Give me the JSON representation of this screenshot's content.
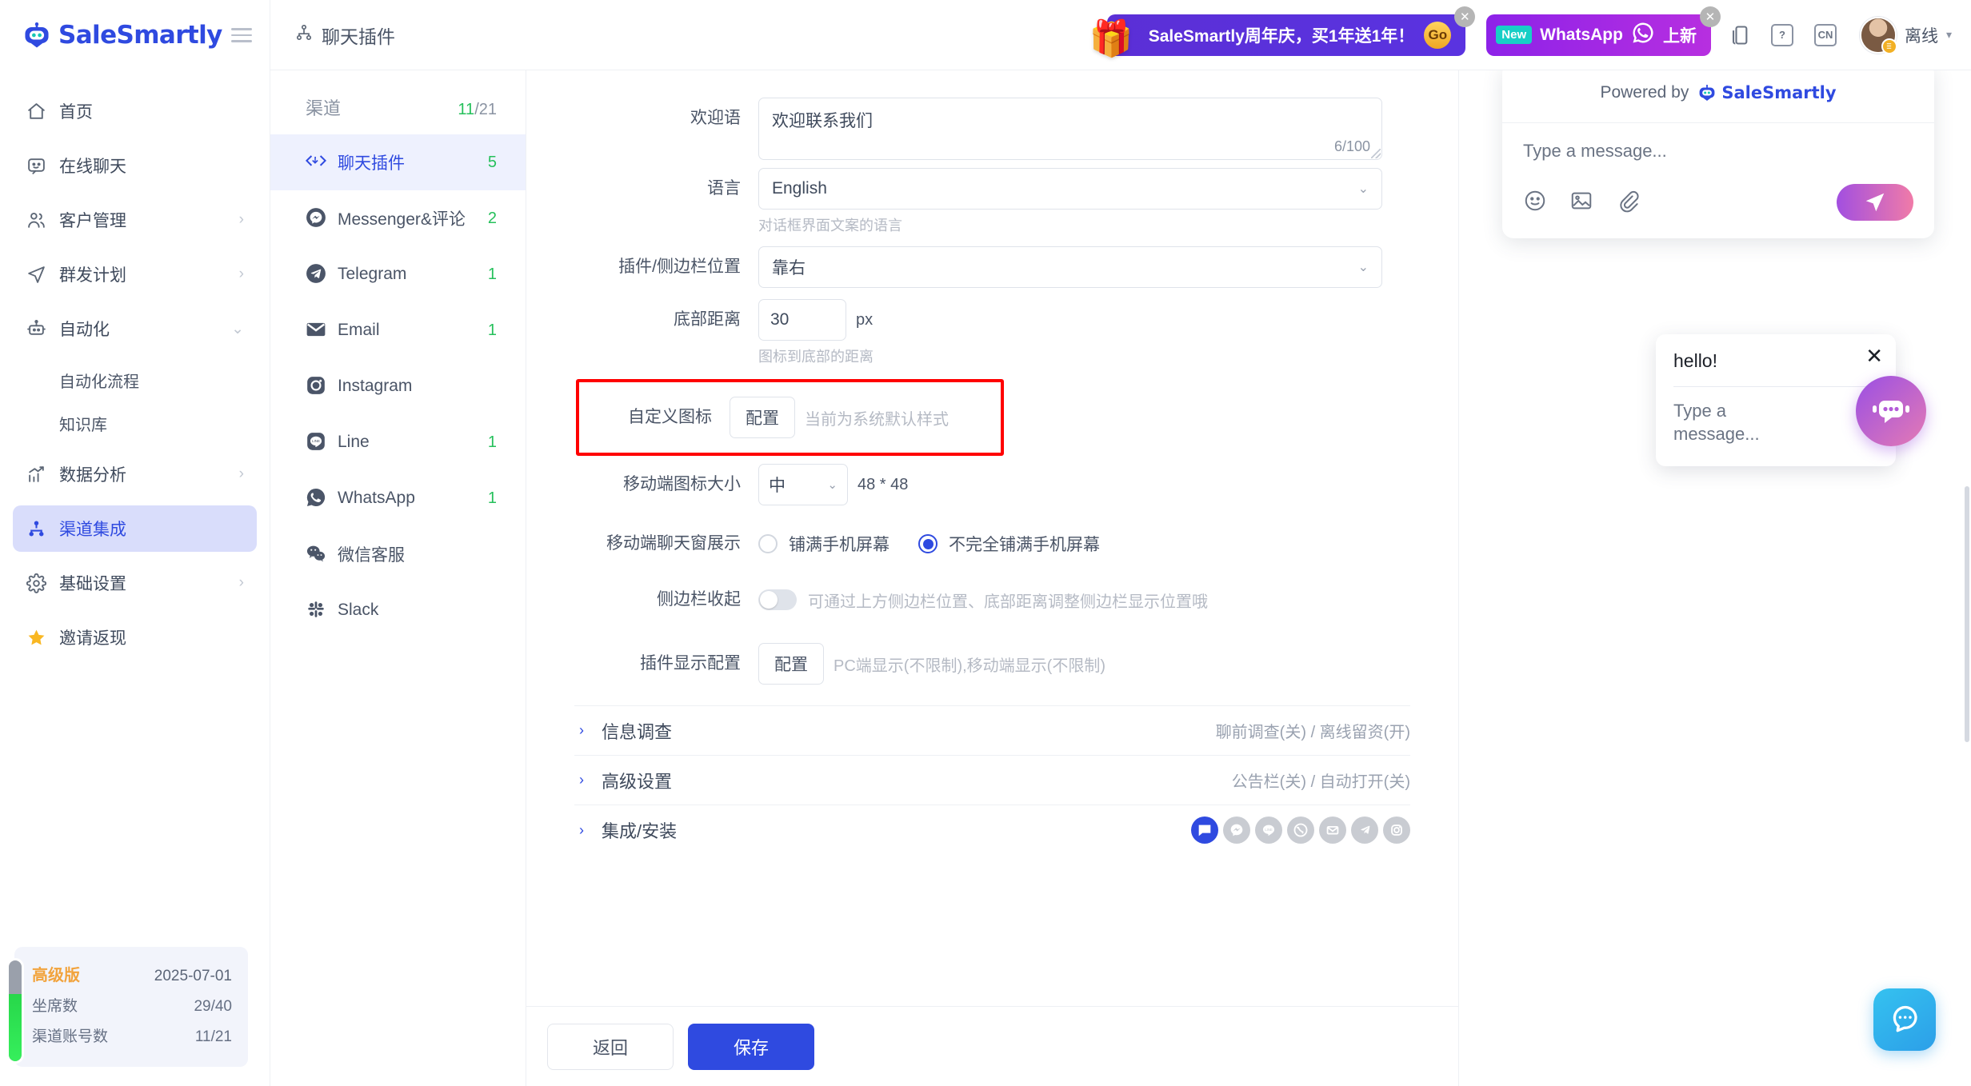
{
  "brand": {
    "name": "SaleSmartly",
    "menu_icon": "hamburger-icon"
  },
  "sidebar": {
    "items": [
      {
        "label": "首页",
        "icon": "home-icon",
        "arrow": "",
        "active": false
      },
      {
        "label": "在线聊天",
        "icon": "chat-icon",
        "arrow": "",
        "active": false
      },
      {
        "label": "客户管理",
        "icon": "users-icon",
        "arrow": "›",
        "active": false
      },
      {
        "label": "群发计划",
        "icon": "send-icon",
        "arrow": "›",
        "active": false
      },
      {
        "label": "自动化",
        "icon": "robot-icon",
        "arrow": "⌄",
        "active": false
      },
      {
        "label": "数据分析",
        "icon": "analytics-icon",
        "arrow": "›",
        "active": false
      },
      {
        "label": "渠道集成",
        "icon": "sitemap-icon",
        "arrow": "",
        "active": true
      },
      {
        "label": "基础设置",
        "icon": "gear-icon",
        "arrow": "›",
        "active": false
      },
      {
        "label": "邀请返现",
        "icon": "star-icon",
        "arrow": "",
        "active": false
      }
    ],
    "sub_items": [
      {
        "label": "自动化流程"
      },
      {
        "label": "知识库"
      }
    ],
    "plan": {
      "name": "高级版",
      "expiry": "2025-07-01",
      "seats_label": "坐席数",
      "seats_value": "29/40",
      "channels_label": "渠道账号数",
      "channels_value": "11/21"
    }
  },
  "topbar": {
    "page_title": "聊天插件",
    "page_title_icon": "sitemap-icon",
    "promo_anniversary": "SaleSmartly周年庆，买1年送1年！",
    "promo_anniversary_cta": "Go",
    "promo_whatsapp_badge": "New",
    "promo_whatsapp": "WhatsApp",
    "promo_whatsapp_suffix": "上新",
    "lang_button": "CN",
    "help_icon": "question-icon",
    "mobile_icon": "mobile-preview-icon",
    "user_status": "离线",
    "user_caret": "▾"
  },
  "channels": {
    "header_label": "渠道",
    "header_count": "11",
    "header_total": "/21",
    "items": [
      {
        "label": "聊天插件",
        "icon": "code-brackets-icon",
        "count": "5",
        "active": true
      },
      {
        "label": "Messenger&评论",
        "icon": "messenger-icon",
        "count": "2",
        "active": false
      },
      {
        "label": "Telegram",
        "icon": "telegram-icon",
        "count": "1",
        "active": false
      },
      {
        "label": "Email",
        "icon": "email-icon",
        "count": "1",
        "active": false
      },
      {
        "label": "Instagram",
        "icon": "instagram-icon",
        "count": "",
        "active": false
      },
      {
        "label": "Line",
        "icon": "line-icon",
        "count": "1",
        "active": false
      },
      {
        "label": "WhatsApp",
        "icon": "whatsapp-icon",
        "count": "1",
        "active": false
      },
      {
        "label": "微信客服",
        "icon": "wechat-icon",
        "count": "",
        "active": false
      },
      {
        "label": "Slack",
        "icon": "slack-icon",
        "count": "",
        "active": false
      }
    ]
  },
  "form": {
    "welcome": {
      "label": "欢迎语",
      "value": "欢迎联系我们",
      "counter": "6/100"
    },
    "language": {
      "label": "语言",
      "value": "English",
      "hint": "对话框界面文案的语言"
    },
    "position": {
      "label": "插件/侧边栏位置",
      "value": "靠右"
    },
    "bottom_distance": {
      "label": "底部距离",
      "value": "30",
      "unit": "px",
      "hint": "图标到底部的距离"
    },
    "custom_icon": {
      "label": "自定义图标",
      "button": "配置",
      "note": "当前为系统默认样式"
    },
    "mobile_icon_size": {
      "label": "移动端图标大小",
      "value": "中",
      "note": "48 * 48"
    },
    "mobile_chat_display": {
      "label": "移动端聊天窗展示",
      "option1": "铺满手机屏幕",
      "option2": "不完全铺满手机屏幕",
      "selected": 2
    },
    "sidebar_collapse": {
      "label": "侧边栏收起",
      "state": "off",
      "note": "可通过上方侧边栏位置、底部距离调整侧边栏显示位置哦"
    },
    "plugin_display": {
      "label": "插件显示配置",
      "button": "配置",
      "note": "PC端显示(不限制),移动端显示(不限制)"
    },
    "sections": [
      {
        "title": "信息调查",
        "meta": "聊前调查(关) / 离线留资(开)",
        "chevron": "›"
      },
      {
        "title": "高级设置",
        "meta": "公告栏(关) / 自动打开(关)",
        "chevron": "›"
      },
      {
        "title": "集成/安装",
        "meta": "",
        "chevron": "›",
        "icons": [
          {
            "name": "chat-plugin-icon",
            "selected": true
          },
          {
            "name": "messenger-icon",
            "selected": false
          },
          {
            "name": "line-icon",
            "selected": false
          },
          {
            "name": "whatsapp-icon",
            "selected": false
          },
          {
            "name": "email-icon",
            "selected": false
          },
          {
            "name": "telegram-icon",
            "selected": false
          },
          {
            "name": "instagram-icon",
            "selected": false
          }
        ]
      }
    ],
    "footer": {
      "back": "返回",
      "save": "保存"
    }
  },
  "preview": {
    "powered_by": "Powered by",
    "powered_brand": "SaleSmartly",
    "composer_placeholder": "Type a message...",
    "tools": [
      "emoji-icon",
      "image-icon",
      "attachment-icon"
    ],
    "send_icon": "send-icon",
    "bubble_text": "hello!",
    "bubble_placeholder": "Type a message...",
    "bubble_close": "✕",
    "launcher_icon": "robot-chat-icon"
  },
  "help_fab": {
    "icon": "help-chat-icon"
  },
  "colors": {
    "accent": "#2f4ae0",
    "sidebar_active_bg": "#d9ddfb",
    "success_green": "#25c05b",
    "highlight_red": "#ff0000",
    "plan_orange": "#f2a33c"
  }
}
